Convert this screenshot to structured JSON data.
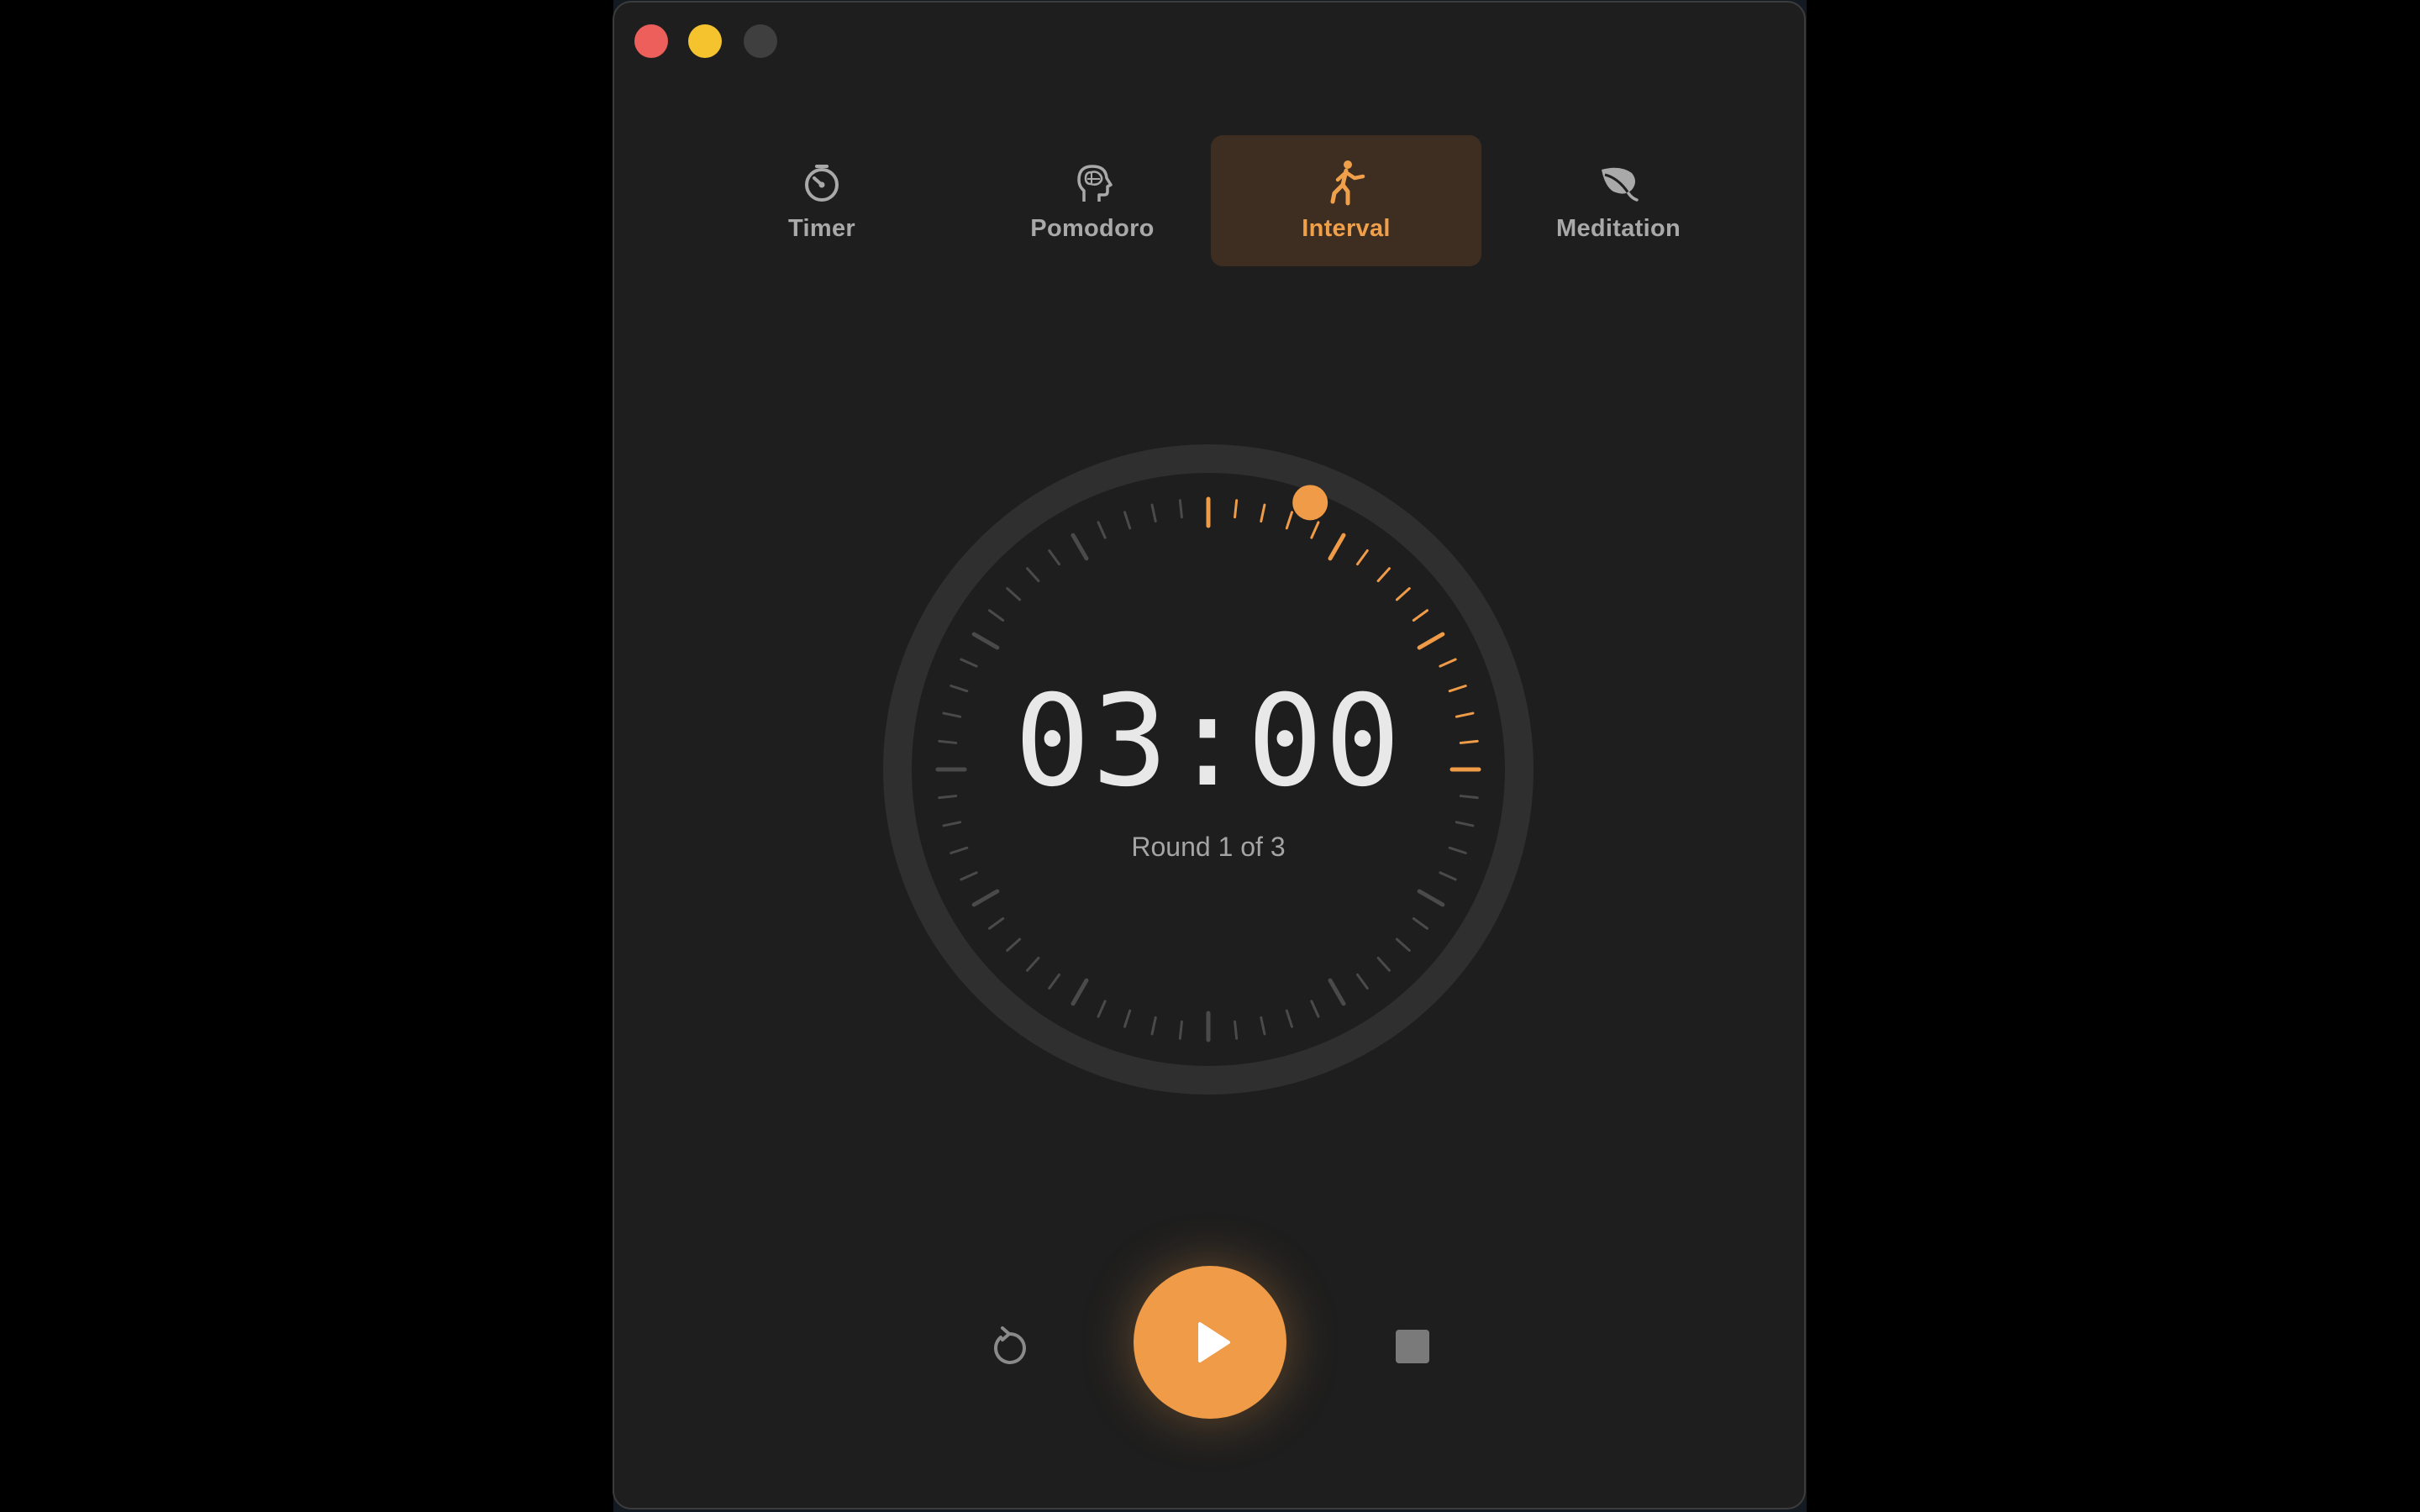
{
  "window": {
    "traffic_lights": [
      "close",
      "minimize",
      "zoom"
    ],
    "colors": {
      "close": "#ec5f5a",
      "minimize": "#f5c32e",
      "zoom": "#3f3f3f",
      "background": "#1e1e1e"
    }
  },
  "tabs": [
    {
      "label": "Timer",
      "icon": "stopwatch-icon",
      "active": false
    },
    {
      "label": "Pomodoro",
      "icon": "brain-head-icon",
      "active": false
    },
    {
      "label": "Interval",
      "icon": "running-figure-icon",
      "active": true
    },
    {
      "label": "Meditation",
      "icon": "leaf-icon",
      "active": false
    }
  ],
  "timer": {
    "time": "03:00",
    "round": "Round 1 of 3",
    "progress": 0.0,
    "highlighted_arc_fraction": 0.25
  },
  "controls": {
    "reset_icon": "reset-icon",
    "play_icon": "play-icon",
    "stop_icon": "stop-icon"
  },
  "colors": {
    "accent": "#ef9b47",
    "active_tab_bg": "#3e2e22",
    "text_primary": "#e8e8e8",
    "text_secondary": "#a5a5a5",
    "tick_inactive": "#4a4a4a",
    "ring": "#2f2f2f"
  }
}
